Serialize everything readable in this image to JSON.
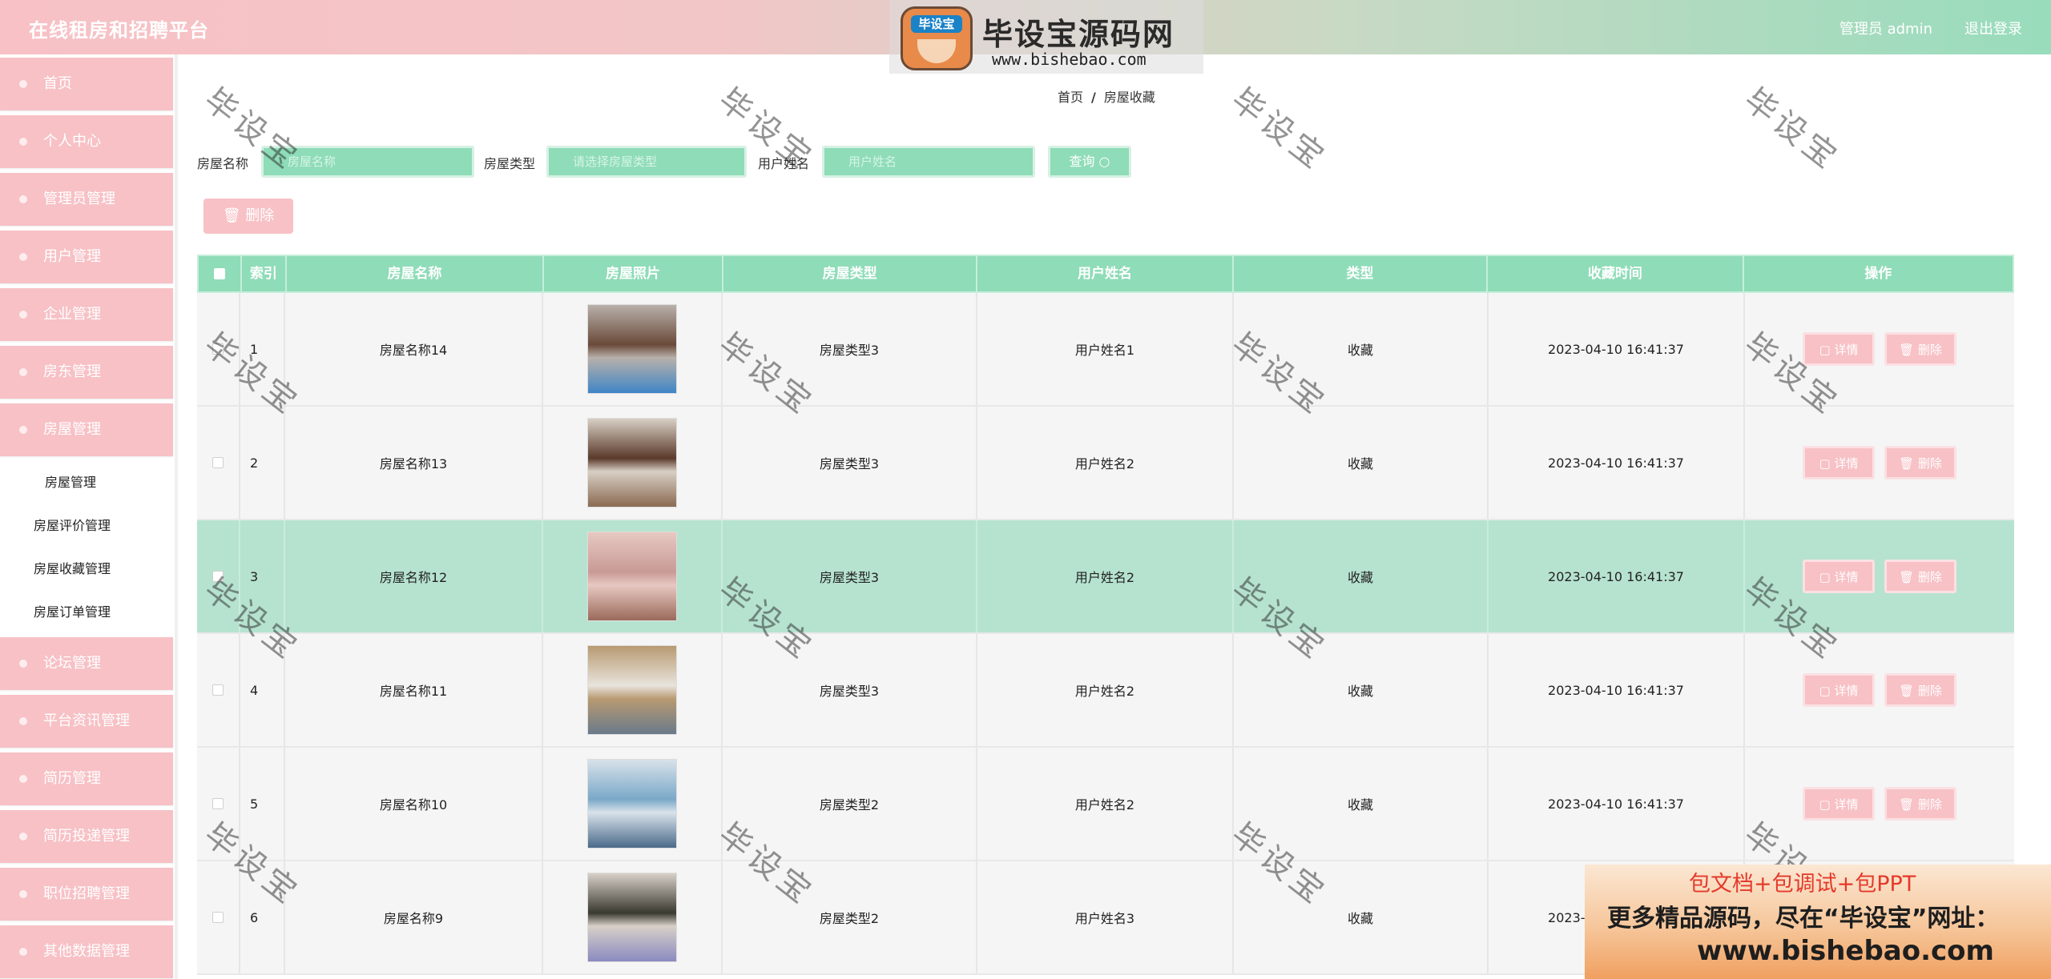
{
  "header": {
    "title": "在线租房和招聘平台",
    "admin_label": "管理员 admin",
    "logout_label": "退出登录"
  },
  "watermark_logo": {
    "badge_text": "毕设宝",
    "brand": "毕设宝源码网",
    "url": "www.bishebao.com"
  },
  "sidebar": {
    "items": [
      {
        "label": "首页"
      },
      {
        "label": "个人中心"
      },
      {
        "label": "管理员管理"
      },
      {
        "label": "用户管理"
      },
      {
        "label": "企业管理"
      },
      {
        "label": "房东管理"
      },
      {
        "label": "房屋管理"
      }
    ],
    "subitems": [
      {
        "label": "房屋管理"
      },
      {
        "label": "房屋评价管理"
      },
      {
        "label": "房屋收藏管理"
      },
      {
        "label": "房屋订单管理"
      }
    ],
    "items_after": [
      {
        "label": "论坛管理"
      },
      {
        "label": "平台资讯管理"
      },
      {
        "label": "简历管理"
      },
      {
        "label": "简历投递管理"
      },
      {
        "label": "职位招聘管理"
      },
      {
        "label": "其他数据管理"
      }
    ]
  },
  "breadcrumb": {
    "home": "首页",
    "sep": "/",
    "current": "房屋收藏"
  },
  "search": {
    "house_name_label": "房屋名称",
    "house_name_placeholder": "房屋名称",
    "house_type_label": "房屋类型",
    "house_type_placeholder": "请选择房屋类型",
    "user_name_label": "用户姓名",
    "user_name_placeholder": "用户姓名",
    "query_label": "查询 ○"
  },
  "toolbar": {
    "delete_label": "🗑 删除"
  },
  "table": {
    "headers": {
      "index": "索引",
      "name": "房屋名称",
      "photo": "房屋照片",
      "type": "房屋类型",
      "user": "用户姓名",
      "kind": "类型",
      "time": "收藏时间",
      "ops": "操作"
    },
    "detail_label": "▢ 详情",
    "delete_label": "🗑 删除",
    "rows": [
      {
        "index": "1",
        "name": "房屋名称14",
        "type": "房屋类型3",
        "user": "用户姓名1",
        "kind": "收藏",
        "time": "2023-04-10 16:41:37",
        "photo_colors": [
          "#6a4a3a",
          "#b8b0aa",
          "#3f86c6"
        ]
      },
      {
        "index": "2",
        "name": "房屋名称13",
        "type": "房屋类型3",
        "user": "用户姓名2",
        "kind": "收藏",
        "time": "2023-04-10 16:41:37",
        "photo_colors": [
          "#5a3a2a",
          "#d8cfc4",
          "#8a6a52"
        ]
      },
      {
        "index": "3",
        "name": "房屋名称12",
        "type": "房屋类型3",
        "user": "用户姓名2",
        "kind": "收藏",
        "time": "2023-04-10 16:41:37",
        "photo_colors": [
          "#c89a96",
          "#e8c8c2",
          "#9a6a5a"
        ]
      },
      {
        "index": "4",
        "name": "房屋名称11",
        "type": "房屋类型3",
        "user": "用户姓名2",
        "kind": "收藏",
        "time": "2023-04-10 16:41:37",
        "photo_colors": [
          "#e8e4dc",
          "#b89a72",
          "#6a7a8a"
        ]
      },
      {
        "index": "5",
        "name": "房屋名称10",
        "type": "房屋类型2",
        "user": "用户姓名2",
        "kind": "收藏",
        "time": "2023-04-10 16:41:37",
        "photo_colors": [
          "#7aa8c8",
          "#d8e2ea",
          "#4a6a8a"
        ]
      },
      {
        "index": "6",
        "name": "房屋名称9",
        "type": "房屋类型2",
        "user": "用户姓名3",
        "kind": "收藏",
        "time": "2023-04-10 16:41:37",
        "photo_colors": [
          "#3a3a30",
          "#d8d0c8",
          "#8a8ac0"
        ]
      }
    ]
  },
  "watermark_text": "毕设宝",
  "promo": {
    "line1": "包文档+包调试+包PPT",
    "line2": "更多精品源码，尽在“毕设宝”网址：",
    "line3": "www.bishebao.com"
  },
  "colors": {
    "mint": "#8fdcb8",
    "pink": "#f7c1c6",
    "highlight_row": "#b6e3cf"
  }
}
